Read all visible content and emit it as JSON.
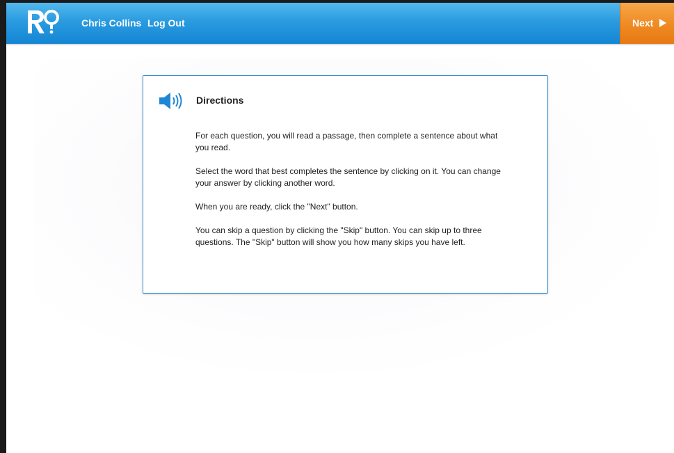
{
  "header": {
    "logo_text": "R?",
    "user_name": "Chris Collins",
    "logout_label": "Log Out",
    "next_label": "Next",
    "colors": {
      "bar": "#2a9be0",
      "next_button": "#ef8a22"
    }
  },
  "directions": {
    "speaker_icon": "speaker-icon",
    "title": "Directions",
    "paragraphs": [
      "For each question, you will read a passage, then complete a sentence about what you read.",
      "Select the word that best completes the sentence by clicking on it.  You can change your answer by clicking another word.",
      "When you are ready, click the \"Next\" button.",
      "You can skip a question by clicking the \"Skip\" button.  You can skip up to three questions.  The \"Skip\" button will show you how many skips you have left."
    ]
  }
}
